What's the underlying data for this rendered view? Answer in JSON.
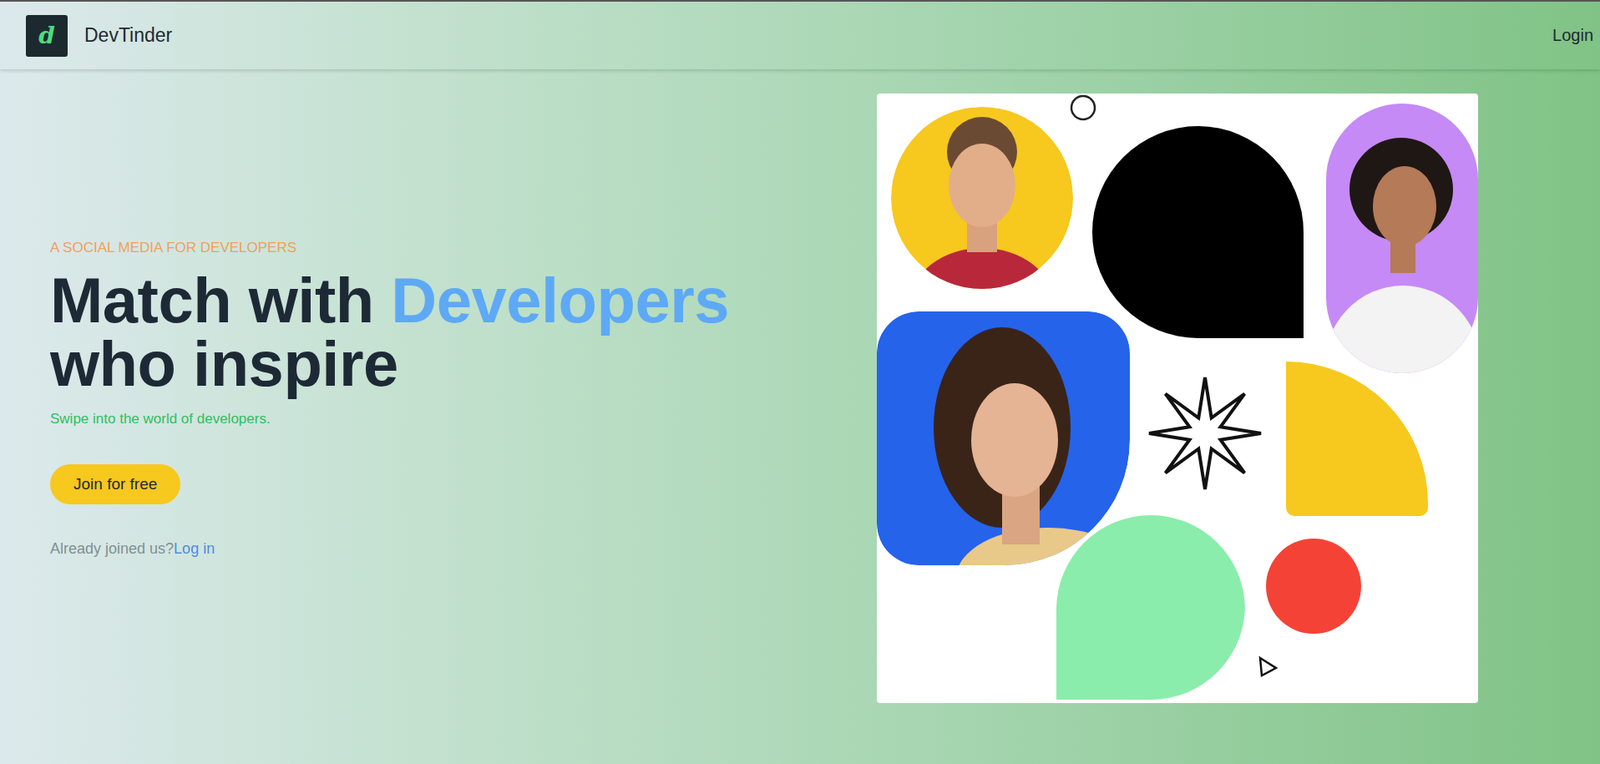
{
  "navbar": {
    "logo_glyph": "d",
    "brand": "DevTinder",
    "login": "Login"
  },
  "hero": {
    "tagline": "A SOCIAL MEDIA FOR DEVELOPERS",
    "title": {
      "before": "Match with",
      "highlight": "Developers",
      "after": "who inspire"
    },
    "subtitle": "Swipe into the world of developers.",
    "cta": "Join for free",
    "login_prompt": {
      "text": "Already joined us?",
      "link": "Log in"
    }
  }
}
